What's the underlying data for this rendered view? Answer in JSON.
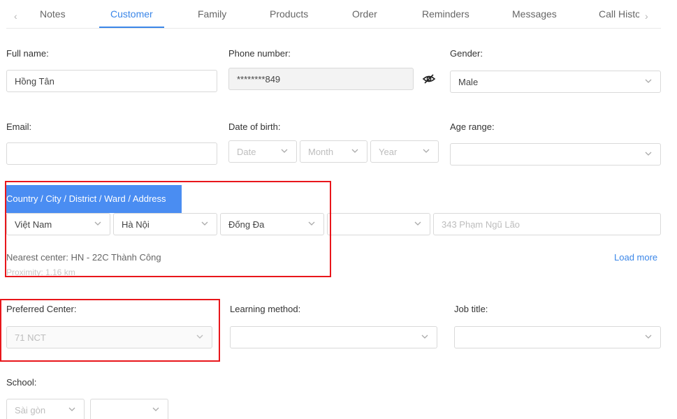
{
  "tabs": {
    "items": [
      {
        "label": "Notes"
      },
      {
        "label": "Customer"
      },
      {
        "label": "Family"
      },
      {
        "label": "Products"
      },
      {
        "label": "Order"
      },
      {
        "label": "Reminders"
      },
      {
        "label": "Messages"
      },
      {
        "label": "Call Histo"
      }
    ],
    "active": "Customer",
    "prev_arrow": "‹",
    "next_arrow": "›"
  },
  "form": {
    "full_name": {
      "label": "Full name:",
      "value": "Hồng Tân"
    },
    "phone": {
      "label": "Phone number:",
      "value": "********849"
    },
    "gender": {
      "label": "Gender:",
      "value": "Male"
    },
    "email": {
      "label": "Email:",
      "value": ""
    },
    "dob": {
      "label": "Date of birth:",
      "day_placeholder": "Date",
      "month_placeholder": "Month",
      "year_placeholder": "Year"
    },
    "age_range": {
      "label": "Age range:",
      "value": ""
    },
    "address": {
      "title": "Country / City / District / Ward / Address",
      "country": "Việt Nam",
      "city": "Hà Nội",
      "district": "Đống Đa",
      "ward": "",
      "street_placeholder": "343 Phạm Ngũ Lão",
      "nearest_center": "Nearest center: HN - 22C Thành Công",
      "proximity": "Proximity: 1.16 km",
      "load_more": "Load more"
    },
    "preferred_center": {
      "label": "Preferred Center:",
      "value": "71 NCT"
    },
    "learning_method": {
      "label": "Learning method:",
      "value": ""
    },
    "job_title": {
      "label": "Job title:",
      "value": ""
    },
    "school": {
      "label": "School:",
      "value": "Sài gòn",
      "second": ""
    }
  },
  "colors": {
    "accent": "#3a86e8",
    "highlight": "#e8161b",
    "title_bg": "#4a8df2"
  },
  "icons": {
    "chevron": "chevron-down-icon",
    "eye": "eye-off-icon"
  }
}
